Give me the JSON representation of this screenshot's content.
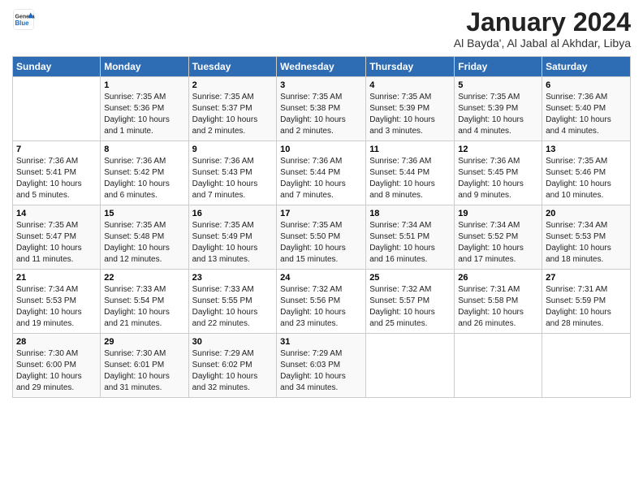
{
  "logo": {
    "general": "General",
    "blue": "Blue"
  },
  "title": "January 2024",
  "subtitle": "Al Bayda', Al Jabal al Akhdar, Libya",
  "days_header": [
    "Sunday",
    "Monday",
    "Tuesday",
    "Wednesday",
    "Thursday",
    "Friday",
    "Saturday"
  ],
  "weeks": [
    [
      {
        "day": "",
        "info": ""
      },
      {
        "day": "1",
        "info": "Sunrise: 7:35 AM\nSunset: 5:36 PM\nDaylight: 10 hours\nand 1 minute."
      },
      {
        "day": "2",
        "info": "Sunrise: 7:35 AM\nSunset: 5:37 PM\nDaylight: 10 hours\nand 2 minutes."
      },
      {
        "day": "3",
        "info": "Sunrise: 7:35 AM\nSunset: 5:38 PM\nDaylight: 10 hours\nand 2 minutes."
      },
      {
        "day": "4",
        "info": "Sunrise: 7:35 AM\nSunset: 5:39 PM\nDaylight: 10 hours\nand 3 minutes."
      },
      {
        "day": "5",
        "info": "Sunrise: 7:35 AM\nSunset: 5:39 PM\nDaylight: 10 hours\nand 4 minutes."
      },
      {
        "day": "6",
        "info": "Sunrise: 7:36 AM\nSunset: 5:40 PM\nDaylight: 10 hours\nand 4 minutes."
      }
    ],
    [
      {
        "day": "7",
        "info": "Sunrise: 7:36 AM\nSunset: 5:41 PM\nDaylight: 10 hours\nand 5 minutes."
      },
      {
        "day": "8",
        "info": "Sunrise: 7:36 AM\nSunset: 5:42 PM\nDaylight: 10 hours\nand 6 minutes."
      },
      {
        "day": "9",
        "info": "Sunrise: 7:36 AM\nSunset: 5:43 PM\nDaylight: 10 hours\nand 7 minutes."
      },
      {
        "day": "10",
        "info": "Sunrise: 7:36 AM\nSunset: 5:44 PM\nDaylight: 10 hours\nand 7 minutes."
      },
      {
        "day": "11",
        "info": "Sunrise: 7:36 AM\nSunset: 5:44 PM\nDaylight: 10 hours\nand 8 minutes."
      },
      {
        "day": "12",
        "info": "Sunrise: 7:36 AM\nSunset: 5:45 PM\nDaylight: 10 hours\nand 9 minutes."
      },
      {
        "day": "13",
        "info": "Sunrise: 7:35 AM\nSunset: 5:46 PM\nDaylight: 10 hours\nand 10 minutes."
      }
    ],
    [
      {
        "day": "14",
        "info": "Sunrise: 7:35 AM\nSunset: 5:47 PM\nDaylight: 10 hours\nand 11 minutes."
      },
      {
        "day": "15",
        "info": "Sunrise: 7:35 AM\nSunset: 5:48 PM\nDaylight: 10 hours\nand 12 minutes."
      },
      {
        "day": "16",
        "info": "Sunrise: 7:35 AM\nSunset: 5:49 PM\nDaylight: 10 hours\nand 13 minutes."
      },
      {
        "day": "17",
        "info": "Sunrise: 7:35 AM\nSunset: 5:50 PM\nDaylight: 10 hours\nand 15 minutes."
      },
      {
        "day": "18",
        "info": "Sunrise: 7:34 AM\nSunset: 5:51 PM\nDaylight: 10 hours\nand 16 minutes."
      },
      {
        "day": "19",
        "info": "Sunrise: 7:34 AM\nSunset: 5:52 PM\nDaylight: 10 hours\nand 17 minutes."
      },
      {
        "day": "20",
        "info": "Sunrise: 7:34 AM\nSunset: 5:53 PM\nDaylight: 10 hours\nand 18 minutes."
      }
    ],
    [
      {
        "day": "21",
        "info": "Sunrise: 7:34 AM\nSunset: 5:53 PM\nDaylight: 10 hours\nand 19 minutes."
      },
      {
        "day": "22",
        "info": "Sunrise: 7:33 AM\nSunset: 5:54 PM\nDaylight: 10 hours\nand 21 minutes."
      },
      {
        "day": "23",
        "info": "Sunrise: 7:33 AM\nSunset: 5:55 PM\nDaylight: 10 hours\nand 22 minutes."
      },
      {
        "day": "24",
        "info": "Sunrise: 7:32 AM\nSunset: 5:56 PM\nDaylight: 10 hours\nand 23 minutes."
      },
      {
        "day": "25",
        "info": "Sunrise: 7:32 AM\nSunset: 5:57 PM\nDaylight: 10 hours\nand 25 minutes."
      },
      {
        "day": "26",
        "info": "Sunrise: 7:31 AM\nSunset: 5:58 PM\nDaylight: 10 hours\nand 26 minutes."
      },
      {
        "day": "27",
        "info": "Sunrise: 7:31 AM\nSunset: 5:59 PM\nDaylight: 10 hours\nand 28 minutes."
      }
    ],
    [
      {
        "day": "28",
        "info": "Sunrise: 7:30 AM\nSunset: 6:00 PM\nDaylight: 10 hours\nand 29 minutes."
      },
      {
        "day": "29",
        "info": "Sunrise: 7:30 AM\nSunset: 6:01 PM\nDaylight: 10 hours\nand 31 minutes."
      },
      {
        "day": "30",
        "info": "Sunrise: 7:29 AM\nSunset: 6:02 PM\nDaylight: 10 hours\nand 32 minutes."
      },
      {
        "day": "31",
        "info": "Sunrise: 7:29 AM\nSunset: 6:03 PM\nDaylight: 10 hours\nand 34 minutes."
      },
      {
        "day": "",
        "info": ""
      },
      {
        "day": "",
        "info": ""
      },
      {
        "day": "",
        "info": ""
      }
    ]
  ]
}
